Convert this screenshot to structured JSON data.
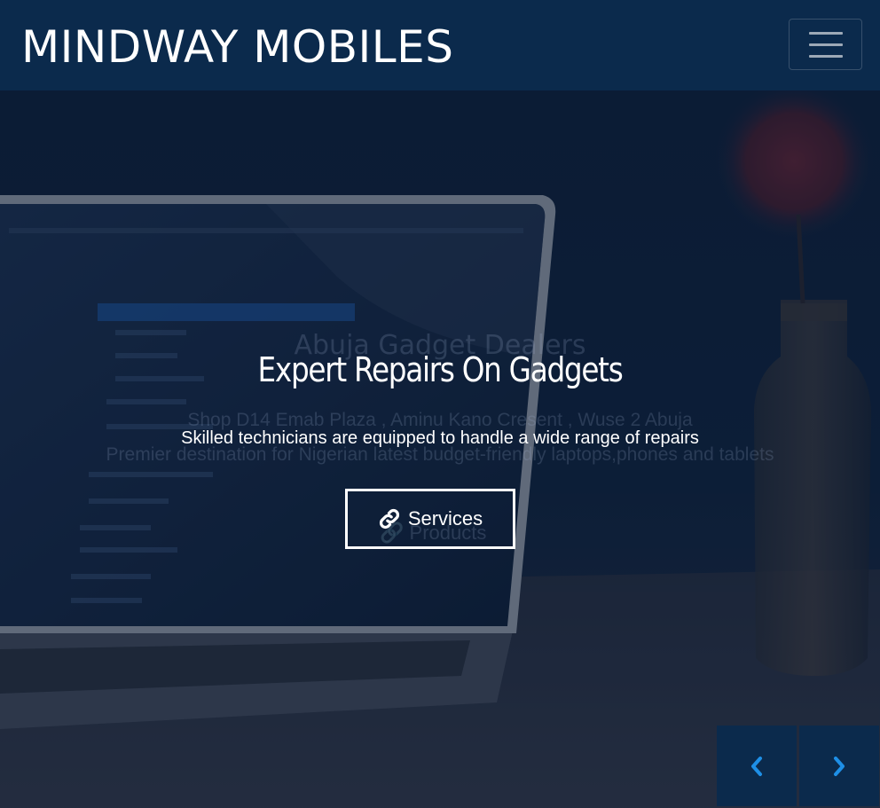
{
  "navbar": {
    "brand": "MINDWAY MOBILES",
    "menu_icon": "hamburger-menu-icon"
  },
  "ghost_slide": {
    "title": "Abuja Gadget Dealers",
    "line1": "Shop D14 Emab Plaza , Aminu Kano Cresent , Wuse 2 Abuja",
    "line2": "Premier destination for Nigerian latest budget-friendly laptops,phones and tablets",
    "button_label": "Products"
  },
  "slide": {
    "title": "Expert Repairs On Gadgets",
    "subtitle": "Skilled technicians are equipped to handle a wide range of repairs",
    "button_label": "Services",
    "button_icon": "link-icon"
  },
  "carousel": {
    "prev_icon": "chevron-left-icon",
    "next_icon": "chevron-right-icon"
  },
  "colors": {
    "navbar_bg": "#0b2a4c",
    "accent": "#1e8fe6",
    "text": "#ffffff"
  }
}
